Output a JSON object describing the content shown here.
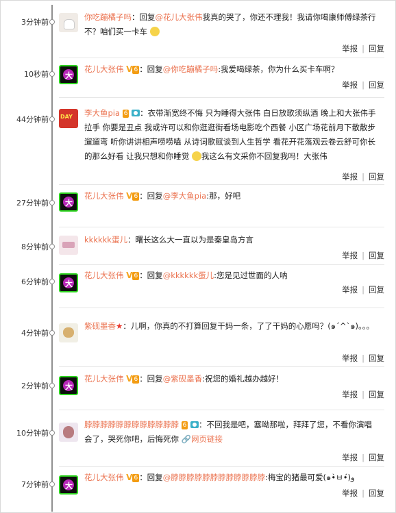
{
  "comments": [
    {
      "time": "3分钟前",
      "user": "你吃蹦橘子吗",
      "reply_prefix": "：回复",
      "reply_to": "@花儿大张伟",
      "text": "我真的哭了，你还不理我！我请你喝康师傅绿茶行不？咱们买一卡车",
      "report": "举报",
      "reply": "回复"
    },
    {
      "time": "10秒前",
      "user": "花儿大张伟",
      "reply_prefix": "：回复",
      "reply_to": "@你吃蹦橘子吗",
      "text": ":我爱喝绿茶，你为什么买卡车啊？",
      "report": "举报",
      "reply": "回复"
    },
    {
      "time": "44分钟前",
      "user": "李大鱼pia",
      "text": "：衣带渐宽终不悔 只为睡得大张伟 白日放歌须纵酒 晚上和大张伟手拉手 你要是丑点 我或许可以和你逛逛街看场电影吃个西餐 小区广场花前月下散散步遛遛弯 听你讲讲相声唠唠嗑 从诗词歌赋谈到人生哲学 看花开花落观云卷云舒可你长的那么好看 让我只想和你睡觉",
      "text2": "我这么有文采你不回复我吗！大张伟",
      "report": "举报",
      "reply": "回复"
    },
    {
      "time": "27分钟前",
      "user": "花儿大张伟",
      "reply_prefix": "：回复",
      "reply_to": "@李大鱼pia",
      "text": ":那，好吧",
      "report": "举报",
      "reply": "回复"
    },
    {
      "time": "8分钟前",
      "user": "kkkkkk蛋儿",
      "text": "：曙长这么大一直以为是秦皇岛方言",
      "report": "举报",
      "reply": "回复"
    },
    {
      "time": "6分钟前",
      "user": "花儿大张伟",
      "reply_prefix": "：回复",
      "reply_to": "@kkkkkk蛋儿",
      "text": ":您是见过世面的人呐",
      "report": "举报",
      "reply": "回复"
    },
    {
      "time": "4分钟前",
      "user": "紫砚墨香",
      "text": "：儿啊，你真的不打算回复干妈一条，了了干妈的心愿吗？(๑´^`๑)。。。",
      "report": "举报",
      "reply": "回复"
    },
    {
      "time": "2分钟前",
      "user": "花儿大张伟",
      "reply_prefix": "：回复",
      "reply_to": "@紫砚墨香",
      "text": ":祝您的婚礼越办越好！",
      "report": "举报",
      "reply": "回复"
    },
    {
      "time": "10分钟前",
      "user": "脖脖脖脖脖脖脖脖脖脖脖脖",
      "text": "：不回我是吧，塞呦那啦，拜拜了您，不看你演唱会了，哭死你吧，后悔死你",
      "link": "网页链接",
      "report": "举报",
      "reply": "回复"
    },
    {
      "time": "7分钟前",
      "user": "花儿大张伟",
      "reply_prefix": "：回复",
      "reply_to": "@脖脖脖脖脖脖脖脖脖脖脖脖",
      "text": ":梅宝的猪最可爱(๑•̀ㅂ•́)و",
      "report": "举报",
      "reply": "回复"
    }
  ]
}
